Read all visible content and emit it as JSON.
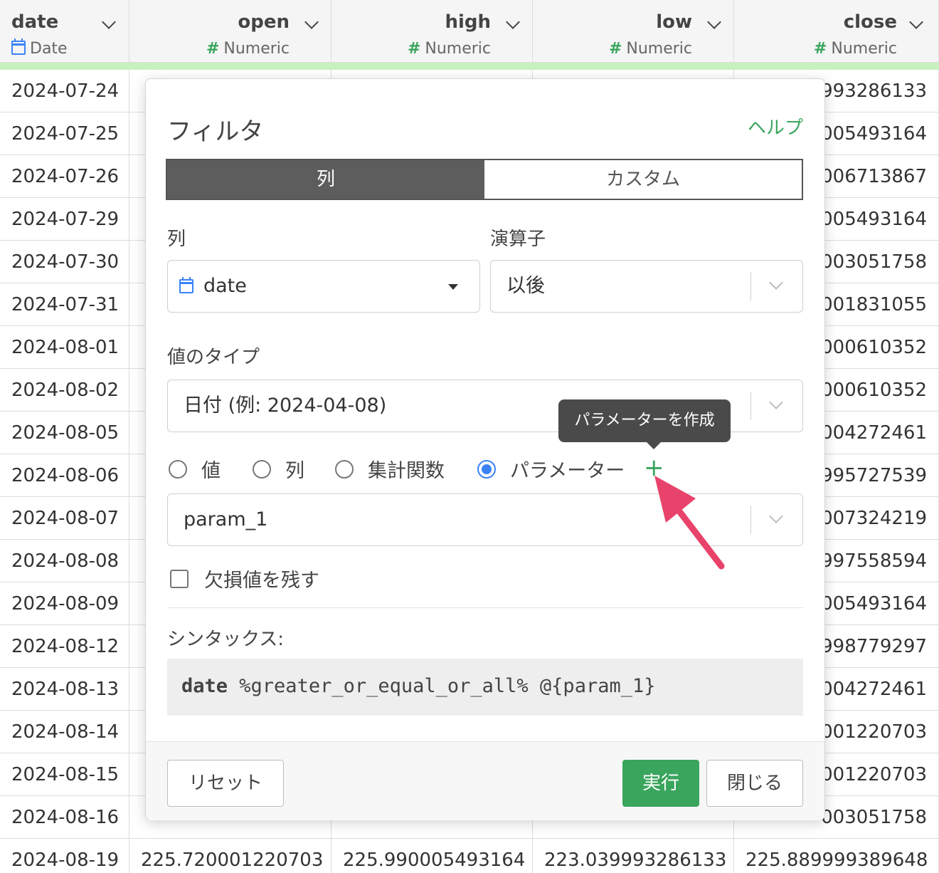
{
  "columns": [
    {
      "name": "date",
      "type": "Date"
    },
    {
      "name": "open",
      "type": "Numeric"
    },
    {
      "name": "high",
      "type": "Numeric"
    },
    {
      "name": "low",
      "type": "Numeric"
    },
    {
      "name": "close",
      "type": "Numeric"
    }
  ],
  "rows": [
    [
      "2024-07-24",
      "",
      "",
      "",
      "993286133"
    ],
    [
      "2024-07-25",
      "",
      "",
      "",
      "005493164"
    ],
    [
      "2024-07-26",
      "",
      "",
      "",
      "006713867"
    ],
    [
      "2024-07-29",
      "",
      "",
      "",
      "005493164"
    ],
    [
      "2024-07-30",
      "",
      "",
      "",
      "003051758"
    ],
    [
      "2024-07-31",
      "",
      "",
      "",
      "001831055"
    ],
    [
      "2024-08-01",
      "",
      "",
      "",
      "000610352"
    ],
    [
      "2024-08-02",
      "",
      "",
      "",
      "000610352"
    ],
    [
      "2024-08-05",
      "",
      "",
      "",
      "004272461"
    ],
    [
      "2024-08-06",
      "",
      "",
      "",
      "995727539"
    ],
    [
      "2024-08-07",
      "",
      "",
      "",
      "007324219"
    ],
    [
      "2024-08-08",
      "",
      "",
      "",
      "997558594"
    ],
    [
      "2024-08-09",
      "",
      "",
      "",
      "005493164"
    ],
    [
      "2024-08-12",
      "",
      "",
      "",
      "998779297"
    ],
    [
      "2024-08-13",
      "",
      "",
      "",
      "004272461"
    ],
    [
      "2024-08-14",
      "",
      "",
      "",
      "001220703"
    ],
    [
      "2024-08-15",
      "",
      "",
      "",
      "001220703"
    ],
    [
      "2024-08-16",
      "",
      "",
      "",
      "003051758"
    ],
    [
      "2024-08-19",
      "225.720001220703",
      "225.990005493164",
      "223.039993286133",
      "225.889999389648"
    ]
  ],
  "dialog": {
    "title": "フィルタ",
    "help": "ヘルプ",
    "tabs": {
      "column": "列",
      "custom": "カスタム"
    },
    "column_label": "列",
    "column_value": "date",
    "operator_label": "演算子",
    "operator_value": "以後",
    "value_type_label": "値のタイプ",
    "value_type_value": "日付 (例: 2024-04-08)",
    "radios": {
      "value": "値",
      "column": "列",
      "aggregate": "集計関数",
      "parameter": "パラメーター"
    },
    "selected_radio": "parameter",
    "tooltip": "パラメーターを作成",
    "plus": "+",
    "param_value": "param_1",
    "keep_na_label": "欠損値を残す",
    "syntax_label": "シンタックス:",
    "syntax_keyword": "date",
    "syntax_rest": " %greater_or_equal_or_all% @{param_1}",
    "buttons": {
      "reset": "リセット",
      "run": "実行",
      "close": "閉じる"
    }
  },
  "colors": {
    "accent_green": "#3aa55d",
    "radio_blue": "#3b82f6",
    "annotation_arrow": "#e8436a"
  }
}
